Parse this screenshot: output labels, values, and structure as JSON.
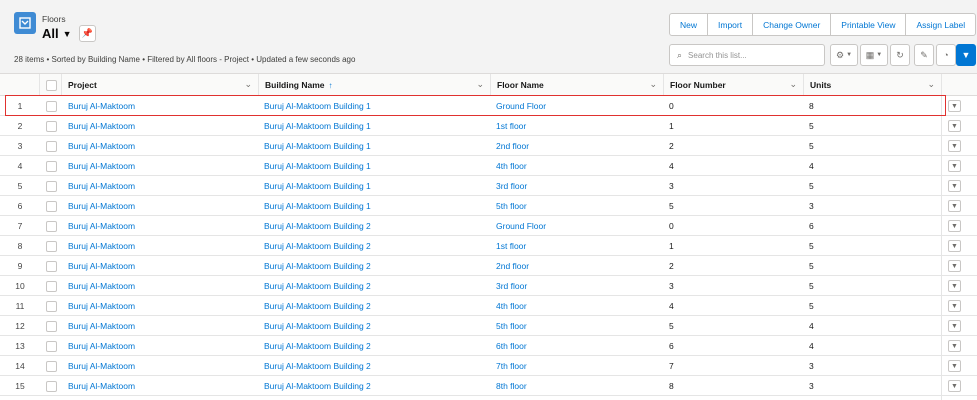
{
  "header": {
    "object_label": "Floors",
    "view_name": "All",
    "summary": "28 items • Sorted by Building Name • Filtered by All floors - Project • Updated a few seconds ago"
  },
  "actions": [
    {
      "label": "New"
    },
    {
      "label": "Import"
    },
    {
      "label": "Change Owner"
    },
    {
      "label": "Printable View"
    },
    {
      "label": "Assign Label"
    }
  ],
  "search": {
    "placeholder": "Search this list..."
  },
  "toolbar_icons": [
    "gear-icon",
    "table-icon",
    "refresh-icon",
    "pencil-icon",
    "chart-icon",
    "filter-icon"
  ],
  "columns": {
    "project": "Project",
    "building": "Building Name",
    "floor_name": "Floor Name",
    "floor_number": "Floor Number",
    "units": "Units"
  },
  "rows": [
    {
      "n": "1",
      "project": "Buruj Al-Maktoom",
      "building": "Buruj Al-Maktoom Building 1",
      "floor": "Ground Floor",
      "floor_number": "0",
      "units": "8"
    },
    {
      "n": "2",
      "project": "Buruj Al-Maktoom",
      "building": "Buruj Al-Maktoom Building 1",
      "floor": "1st floor",
      "floor_number": "1",
      "units": "5"
    },
    {
      "n": "3",
      "project": "Buruj Al-Maktoom",
      "building": "Buruj Al-Maktoom Building 1",
      "floor": "2nd floor",
      "floor_number": "2",
      "units": "5"
    },
    {
      "n": "4",
      "project": "Buruj Al-Maktoom",
      "building": "Buruj Al-Maktoom Building 1",
      "floor": "4th floor",
      "floor_number": "4",
      "units": "4"
    },
    {
      "n": "5",
      "project": "Buruj Al-Maktoom",
      "building": "Buruj Al-Maktoom Building 1",
      "floor": "3rd floor",
      "floor_number": "3",
      "units": "5"
    },
    {
      "n": "6",
      "project": "Buruj Al-Maktoom",
      "building": "Buruj Al-Maktoom Building 1",
      "floor": "5th floor",
      "floor_number": "5",
      "units": "3"
    },
    {
      "n": "7",
      "project": "Buruj Al-Maktoom",
      "building": "Buruj Al-Maktoom Building 2",
      "floor": "Ground Floor",
      "floor_number": "0",
      "units": "6"
    },
    {
      "n": "8",
      "project": "Buruj Al-Maktoom",
      "building": "Buruj Al-Maktoom Building 2",
      "floor": "1st floor",
      "floor_number": "1",
      "units": "5"
    },
    {
      "n": "9",
      "project": "Buruj Al-Maktoom",
      "building": "Buruj Al-Maktoom Building 2",
      "floor": "2nd floor",
      "floor_number": "2",
      "units": "5"
    },
    {
      "n": "10",
      "project": "Buruj Al-Maktoom",
      "building": "Buruj Al-Maktoom Building 2",
      "floor": "3rd floor",
      "floor_number": "3",
      "units": "5"
    },
    {
      "n": "11",
      "project": "Buruj Al-Maktoom",
      "building": "Buruj Al-Maktoom Building 2",
      "floor": "4th floor",
      "floor_number": "4",
      "units": "5"
    },
    {
      "n": "12",
      "project": "Buruj Al-Maktoom",
      "building": "Buruj Al-Maktoom Building 2",
      "floor": "5th floor",
      "floor_number": "5",
      "units": "4"
    },
    {
      "n": "13",
      "project": "Buruj Al-Maktoom",
      "building": "Buruj Al-Maktoom Building 2",
      "floor": "6th floor",
      "floor_number": "6",
      "units": "4"
    },
    {
      "n": "14",
      "project": "Buruj Al-Maktoom",
      "building": "Buruj Al-Maktoom Building 2",
      "floor": "7th floor",
      "floor_number": "7",
      "units": "3"
    },
    {
      "n": "15",
      "project": "Buruj Al-Maktoom",
      "building": "Buruj Al-Maktoom Building 2",
      "floor": "8th floor",
      "floor_number": "8",
      "units": "3"
    }
  ],
  "colors": {
    "link": "#0176d3",
    "highlight": "#e0312f",
    "icon_bg": "#3f8bd4"
  }
}
